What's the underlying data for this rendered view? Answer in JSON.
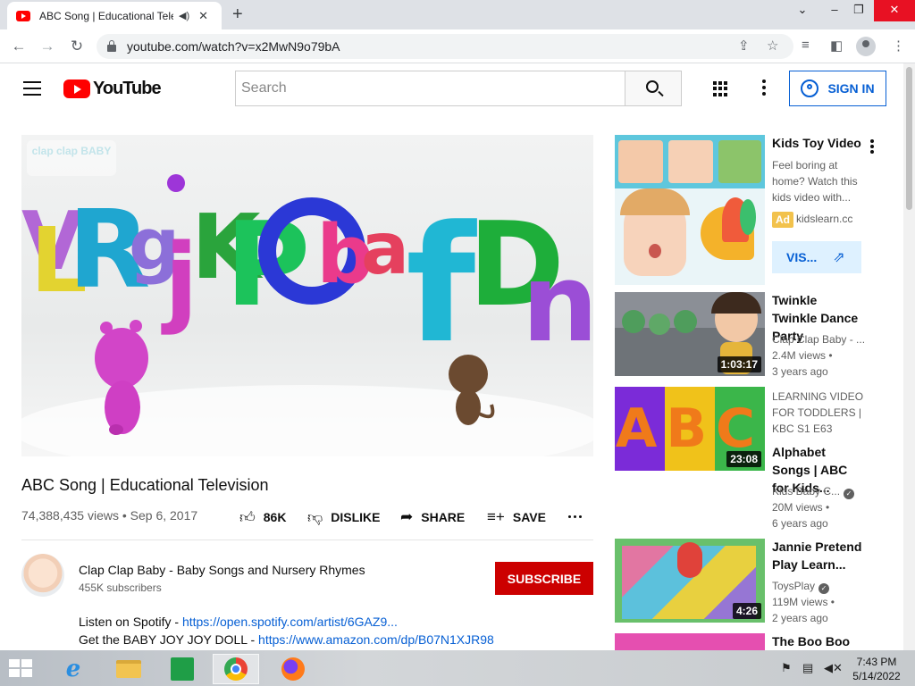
{
  "browser": {
    "tab_title": "ABC Song | Educational Tele",
    "audio_icon": "speaker-icon",
    "url": "youtube.com/watch?v=x2MwN9o79bA"
  },
  "header": {
    "logo_text": "YouTube",
    "search_placeholder": "Search",
    "sign_in": "SIGN IN"
  },
  "video": {
    "watermark": "clap clap BABY",
    "title": "ABC Song | Educational Television",
    "views_date": "74,388,435 views • Sep 6, 2017",
    "likes": "86K",
    "dislike": "DISLIKE",
    "share": "SHARE",
    "save": "SAVE"
  },
  "channel": {
    "name": "Clap Clap Baby - Baby Songs and Nursery Rhymes",
    "subscribers": "455K subscribers",
    "subscribe": "SUBSCRIBE"
  },
  "description": {
    "line1_text": "Listen on Spotify - ",
    "line1_link": "https://open.spotify.com/artist/6GAZ9...",
    "line2_text": "Get the BABY JOY JOY DOLL - ",
    "line2_link": "https://www.amazon.com/dp/B07N1XJR98"
  },
  "ad": {
    "title": "Kids Toy Video",
    "text": "Feel boring at home? Watch this kids video with...",
    "badge": "Ad",
    "domain": "kidslearn.cc",
    "cta": "VIS..."
  },
  "related": [
    {
      "title": "Twinkle Twinkle Dance Party",
      "channel": "Clap Clap Baby - ...",
      "views": "2.4M views •",
      "age": "3 years ago",
      "duration": "1:03:17"
    },
    {
      "extra": "LEARNING VIDEO FOR TODDLERS | KBC  S1 E63",
      "title": "Alphabet Songs | ABC for Kids...",
      "channel": "Kids Baby C...",
      "views": "20M views •",
      "age": "6 years ago",
      "duration": "23:08",
      "thumb_text": "ABC"
    },
    {
      "title": "Jannie Pretend Play Learn...",
      "channel": "ToysPlay",
      "views": "119M views •",
      "age": "2 years ago",
      "duration": "4:26"
    },
    {
      "title": "The Boo Boo"
    }
  ],
  "taskbar": {
    "time": "7:43 PM",
    "date": "5/14/2022"
  },
  "colors": {
    "yt_red": "#ff0000",
    "subscribe_red": "#cc0000",
    "link_blue": "#065fd4",
    "ad_badge": "#f2c24c"
  }
}
